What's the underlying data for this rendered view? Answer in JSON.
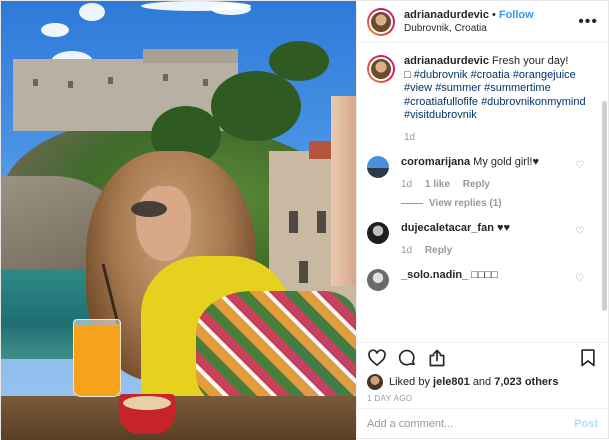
{
  "header": {
    "username": "adrianadurdevic",
    "separator": "•",
    "follow_label": "Follow",
    "location": "Dubrovnik, Croatia",
    "more_icon": "more-horizontal-icon"
  },
  "caption": {
    "username": "adrianadurdevic",
    "text": "Fresh your day!",
    "glyph": "□",
    "hashtags": [
      "#dubrovnik",
      "#croatia",
      "#orangejuice",
      "#view",
      "#summer",
      "#summertime",
      "#croatiafullofife",
      "#dubrovnikonmymind",
      "#visitdubrovnik"
    ],
    "time": "1d"
  },
  "comments": [
    {
      "username": "coromarijana",
      "text": "My gold girl!♥",
      "time": "1d",
      "likes": "1 like",
      "reply": "Reply",
      "view_replies": "View replies (1)"
    },
    {
      "username": "dujecaletacar_fan",
      "text": "♥♥",
      "time": "1d",
      "reply": "Reply"
    },
    {
      "username": "_solo.nadin_",
      "text": "□□□□"
    }
  ],
  "likes": {
    "prefix": "Liked by",
    "user": "jele801",
    "and": "and",
    "others": "7,023 others"
  },
  "timestamp": "1 DAY AGO",
  "add_comment": {
    "placeholder": "Add a comment...",
    "post_label": "Post"
  },
  "colors": {
    "link_blue": "#3897f0",
    "hashtag": "#003569",
    "muted": "#999999"
  }
}
